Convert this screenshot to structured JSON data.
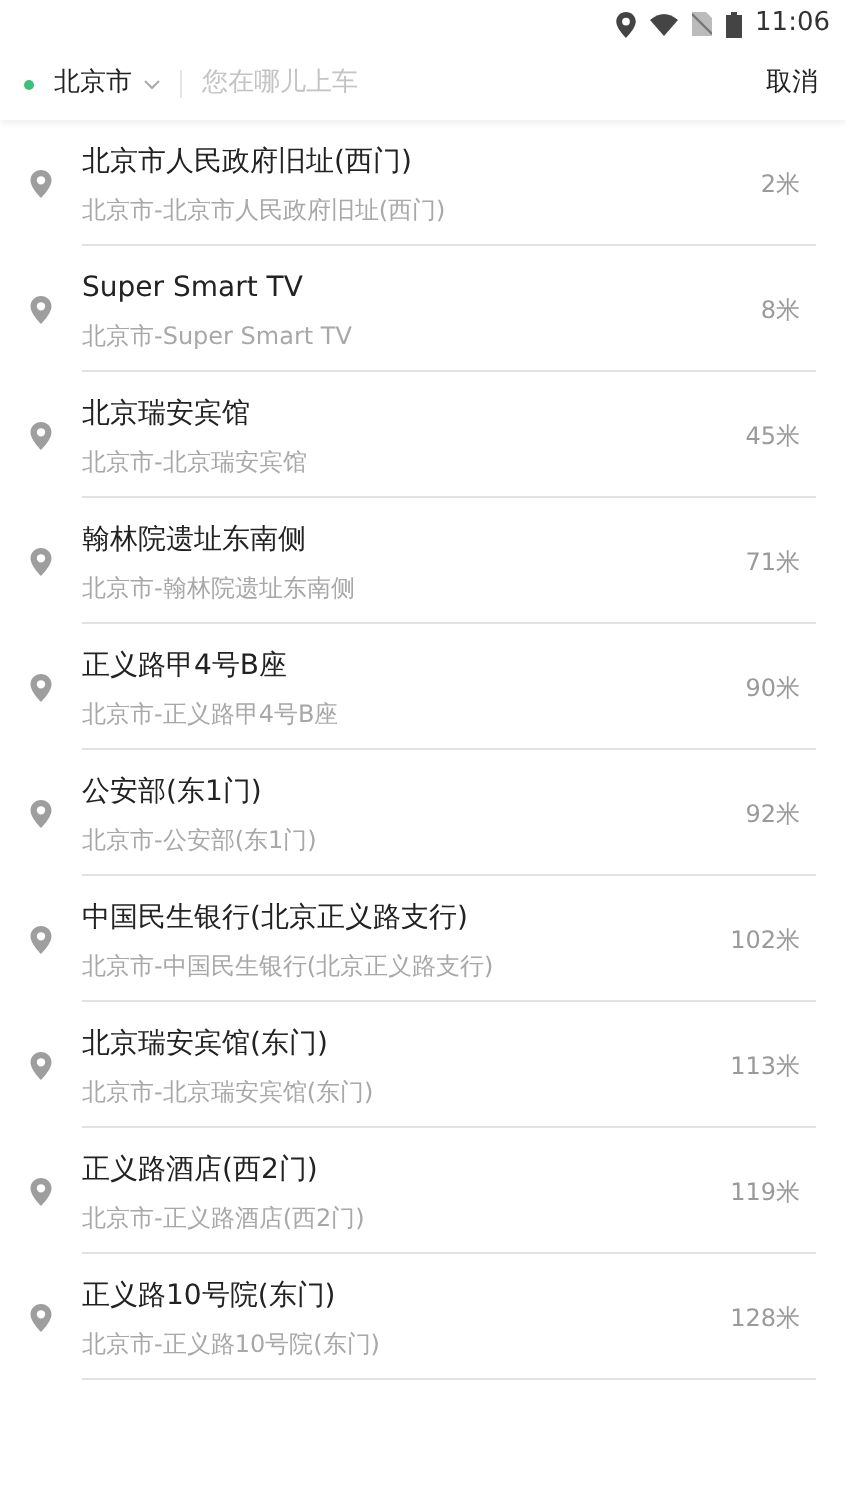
{
  "status_bar": {
    "time": "11:06"
  },
  "search_bar": {
    "city": "北京市",
    "placeholder": "您在哪儿上车",
    "cancel": "取消"
  },
  "results": [
    {
      "name": "北京市人民政府旧址(西门)",
      "address": "北京市-北京市人民政府旧址(西门)",
      "distance": "2米"
    },
    {
      "name": "Super Smart TV",
      "address": "北京市-Super Smart TV",
      "distance": "8米"
    },
    {
      "name": "北京瑞安宾馆",
      "address": "北京市-北京瑞安宾馆",
      "distance": "45米"
    },
    {
      "name": "翰林院遗址东南侧",
      "address": "北京市-翰林院遗址东南侧",
      "distance": "71米"
    },
    {
      "name": "正义路甲4号B座",
      "address": "北京市-正义路甲4号B座",
      "distance": "90米"
    },
    {
      "name": "公安部(东1门)",
      "address": "北京市-公安部(东1门)",
      "distance": "92米"
    },
    {
      "name": "中国民生银行(北京正义路支行)",
      "address": "北京市-中国民生银行(北京正义路支行)",
      "distance": "102米"
    },
    {
      "name": "北京瑞安宾馆(东门)",
      "address": "北京市-北京瑞安宾馆(东门)",
      "distance": "113米"
    },
    {
      "name": "正义路酒店(西2门)",
      "address": "北京市-正义路酒店(西2门)",
      "distance": "119米"
    },
    {
      "name": "正义路10号院(东门)",
      "address": "北京市-正义路10号院(东门)",
      "distance": "128米"
    }
  ]
}
